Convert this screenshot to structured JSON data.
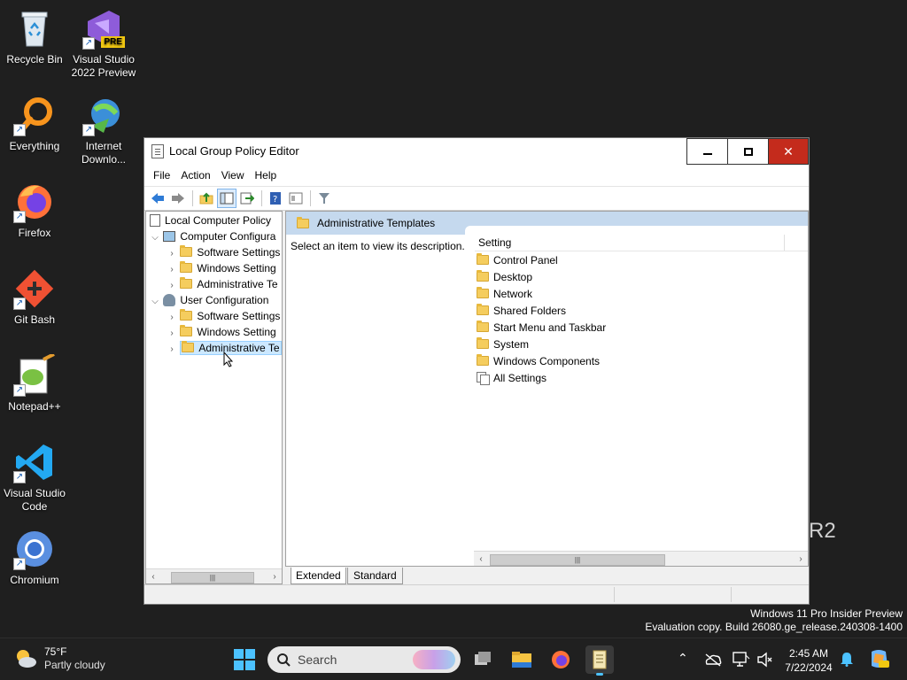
{
  "desktop": {
    "icons": [
      {
        "label": "Recycle Bin"
      },
      {
        "label": "Visual Studio 2022 Preview",
        "badge": "PRE"
      },
      {
        "label": "Everything"
      },
      {
        "label": "Internet Downlo..."
      },
      {
        "label": "Firefox"
      },
      {
        "label": "Git Bash"
      },
      {
        "label": "Notepad++"
      },
      {
        "label": "Visual Studio Code"
      },
      {
        "label": "Chromium"
      }
    ],
    "partial_text": "R2",
    "eval_line1": "Windows 11 Pro Insider Preview",
    "eval_line2": "Evaluation copy. Build 26080.ge_release.240308-1400"
  },
  "window": {
    "title": "Local Group Policy Editor",
    "menu": [
      "File",
      "Action",
      "View",
      "Help"
    ],
    "tree": {
      "root": "Local Computer Policy",
      "computer_config": "Computer Configura",
      "cc_software": "Software Settings",
      "cc_windows": "Windows Setting",
      "cc_admin": "Administrative Te",
      "user_config": "User Configuration",
      "uc_software": "Software Settings",
      "uc_windows": "Windows Setting",
      "uc_admin": "Administrative Te"
    },
    "right": {
      "header": "Administrative Templates",
      "description": "Select an item to view its description.",
      "column": "Setting",
      "items": [
        "Control Panel",
        "Desktop",
        "Network",
        "Shared Folders",
        "Start Menu and Taskbar",
        "System",
        "Windows Components",
        "All Settings"
      ]
    },
    "tabs": {
      "extended": "Extended",
      "standard": "Standard"
    }
  },
  "taskbar": {
    "weather_temp": "75°F",
    "weather_desc": "Partly cloudy",
    "search_placeholder": "Search",
    "time": "2:45 AM",
    "date": "7/22/2024"
  },
  "colors": {
    "accent": "#4cc2ff",
    "close_red": "#c42b1c",
    "selection": "#cce8ff",
    "header_blue": "#c5d9ee"
  }
}
